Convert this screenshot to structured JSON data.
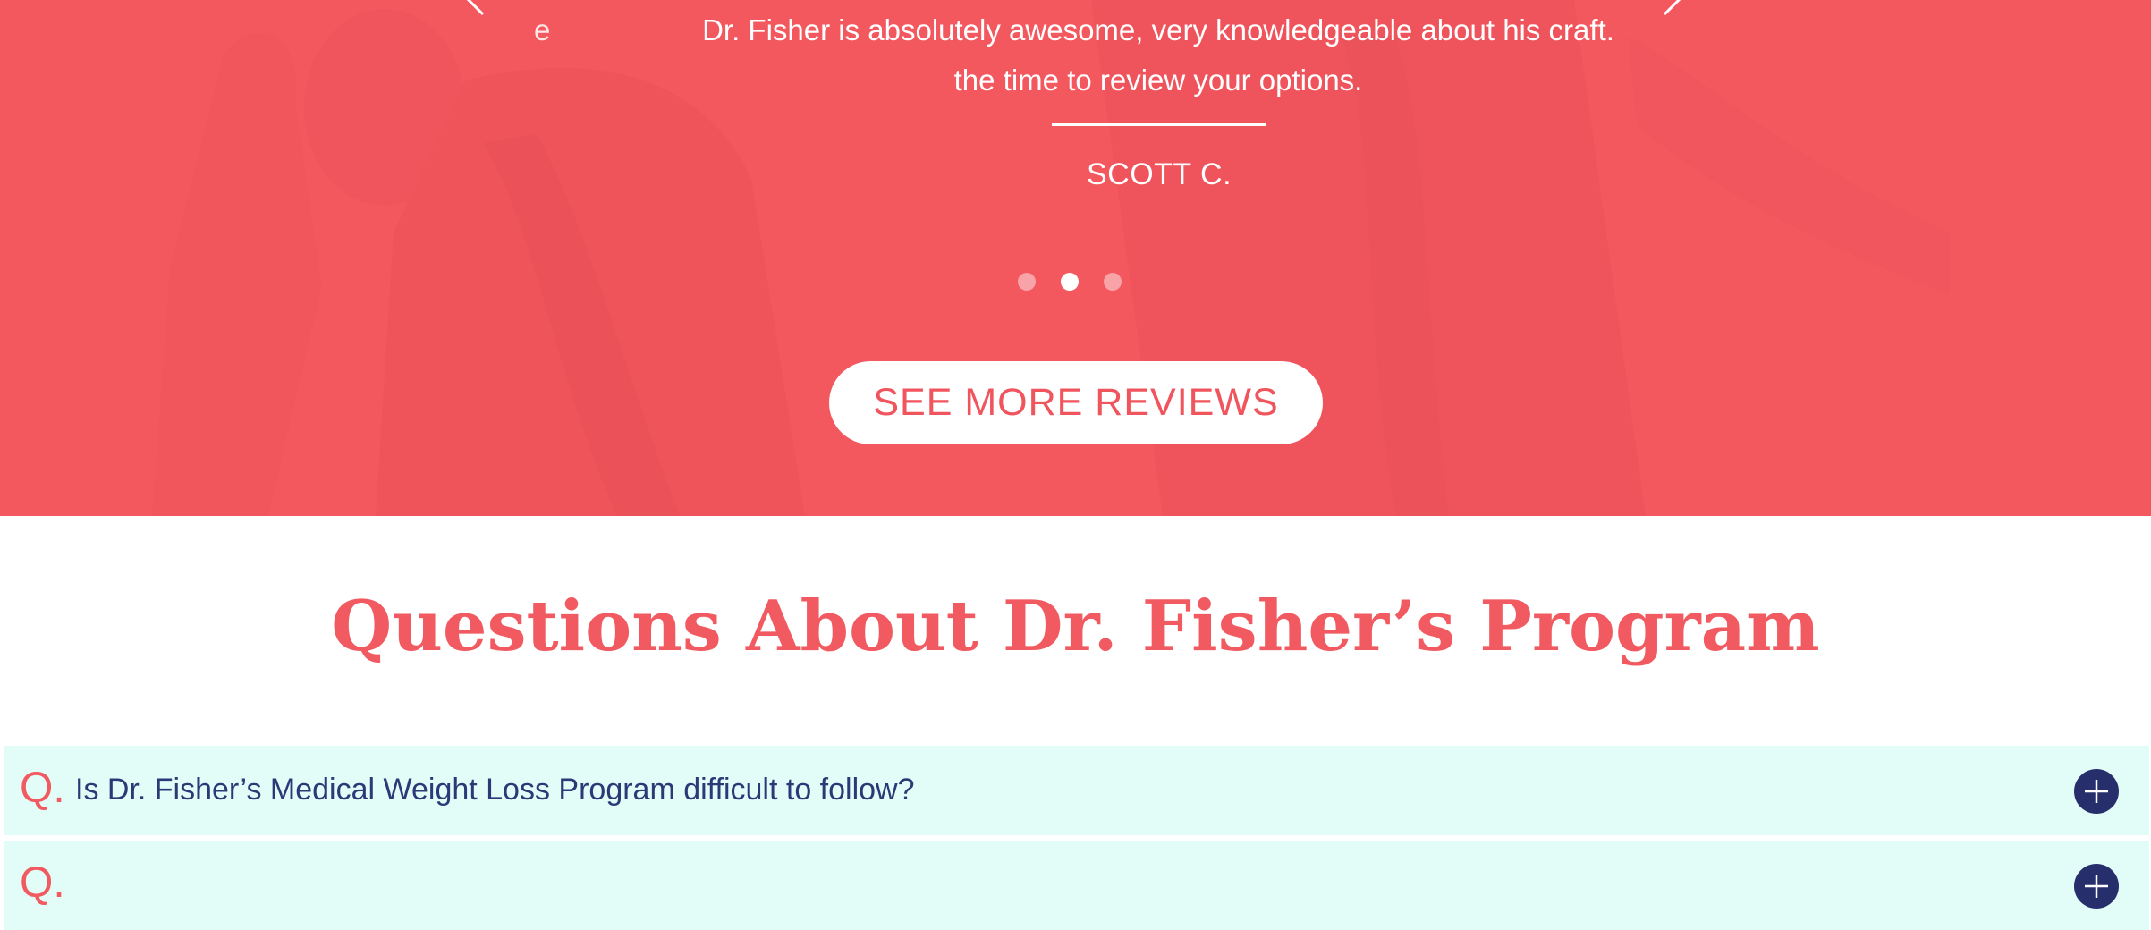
{
  "colors": {
    "hero_overlay": "#f65860",
    "accent": "#f15a60",
    "faq_background": "#e2fcf8",
    "faq_text": "#2b3a77",
    "toggle_background": "#262f6b"
  },
  "testimonial": {
    "fragment": "e",
    "quote_line_1": "Dr. Fisher is absolutely awesome, very knowledgeable about his craft.",
    "quote_line_2": "the time to review your options.",
    "reviewer": "SCOTT C.",
    "slide_count": 3,
    "active_slide": 2,
    "prev_icon": "chevron-left-icon",
    "next_icon": "chevron-right-icon"
  },
  "cta": {
    "label": "SEE MORE REVIEWS"
  },
  "faq": {
    "title": "Questions About Dr. Fisher’s Program",
    "items": [
      {
        "prefix": "Q.",
        "question": "Is Dr. Fisher’s Medical Weight Loss Program difficult to follow?",
        "toggle_icon": "plus-icon"
      },
      {
        "prefix": "Q.",
        "question": "",
        "toggle_icon": "plus-icon"
      }
    ]
  }
}
